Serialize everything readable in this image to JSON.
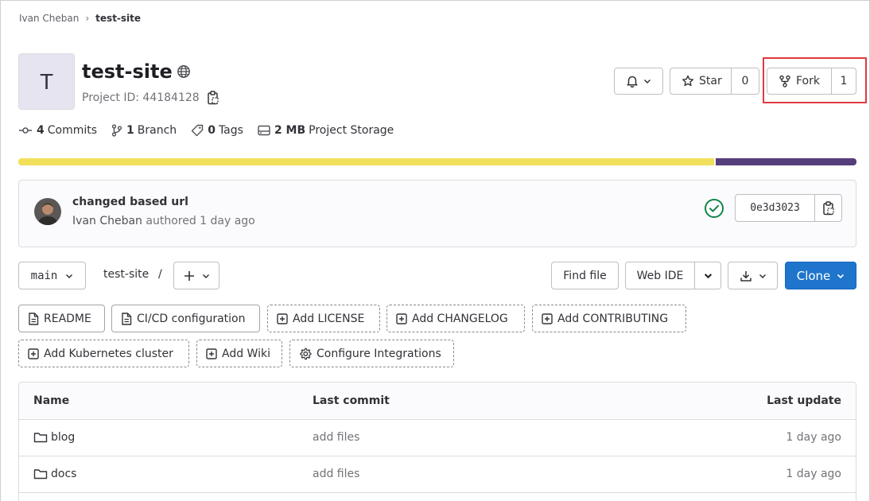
{
  "breadcrumb": {
    "user": "Ivan Cheban",
    "separator": "›",
    "project": "test-site"
  },
  "project": {
    "avatar_letter": "T",
    "name": "test-site",
    "id_label": "Project ID: 44184128"
  },
  "actions": {
    "star_label": "Star",
    "star_count": "0",
    "fork_label": "Fork",
    "fork_count": "1"
  },
  "stats": [
    {
      "icon": "commit-icon",
      "count": "4",
      "label": "Commits"
    },
    {
      "icon": "branch-icon",
      "count": "1",
      "label": "Branch"
    },
    {
      "icon": "tag-icon",
      "count": "0",
      "label": "Tags"
    },
    {
      "icon": "storage-icon",
      "count": "2 MB",
      "label": "Project Storage"
    }
  ],
  "languages": [
    {
      "share": 83,
      "color": "#f1e05a"
    },
    {
      "share": 17,
      "color": "#563d7c"
    }
  ],
  "last_commit": {
    "title": "changed based url",
    "author": "Ivan Cheban",
    "authored_text": "authored 1 day ago",
    "sha": "0e3d3023",
    "status_color": "#108548"
  },
  "toolbar": {
    "branch": "main",
    "path": "test-site",
    "path_separator": "/",
    "find_file": "Find file",
    "web_ide": "Web IDE",
    "clone": "Clone",
    "clone_color": "#1f75cb"
  },
  "quick_actions_row1": [
    {
      "label": "README",
      "icon": "document-icon",
      "style": "solid"
    },
    {
      "label": "CI/CD configuration",
      "icon": "document-icon",
      "style": "solid"
    },
    {
      "label": "Add LICENSE",
      "icon": "plus-square-icon",
      "style": "dashed"
    },
    {
      "label": "Add CHANGELOG",
      "icon": "plus-square-icon",
      "style": "dashed"
    },
    {
      "label": "Add CONTRIBUTING",
      "icon": "plus-square-icon",
      "style": "dashed"
    }
  ],
  "quick_actions_row2": [
    {
      "label": "Add Kubernetes cluster",
      "icon": "plus-square-icon",
      "style": "dashed"
    },
    {
      "label": "Add Wiki",
      "icon": "plus-square-icon",
      "style": "dashed"
    },
    {
      "label": "Configure Integrations",
      "icon": "gear-icon",
      "style": "dashed"
    }
  ],
  "file_table": {
    "headers": {
      "name": "Name",
      "last_commit": "Last commit",
      "last_update": "Last update"
    },
    "rows": [
      {
        "name": "blog",
        "commit": "add files",
        "updated": "1 day ago"
      },
      {
        "name": "docs",
        "commit": "add files",
        "updated": "1 day ago"
      }
    ]
  }
}
